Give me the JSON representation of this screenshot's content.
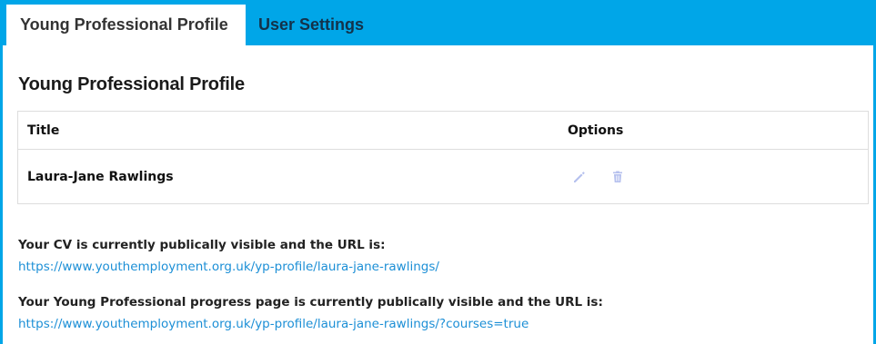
{
  "tabs": [
    {
      "label": "Young Professional Profile",
      "active": true
    },
    {
      "label": "User Settings",
      "active": false
    }
  ],
  "page": {
    "title": "Young Professional Profile"
  },
  "table": {
    "headers": {
      "title": "Title",
      "options": "Options"
    },
    "rows": [
      {
        "title": "Laura-Jane Rawlings",
        "actions": [
          "pencil-icon",
          "trash-icon"
        ]
      }
    ]
  },
  "info": {
    "cv_label": "Your CV is currently publically visible and the URL is:",
    "cv_url": "https://www.youthemployment.org.uk/yp-profile/laura-jane-rawlings/",
    "progress_label": "Your Young Professional progress page is currently publically visible and the URL is:",
    "progress_url": "https://www.youthemployment.org.uk/yp-profile/laura-jane-rawlings/?courses=true"
  },
  "colors": {
    "brand": "#00a6e8",
    "link": "#1c8fd6",
    "icon": "#b5c0ee"
  }
}
